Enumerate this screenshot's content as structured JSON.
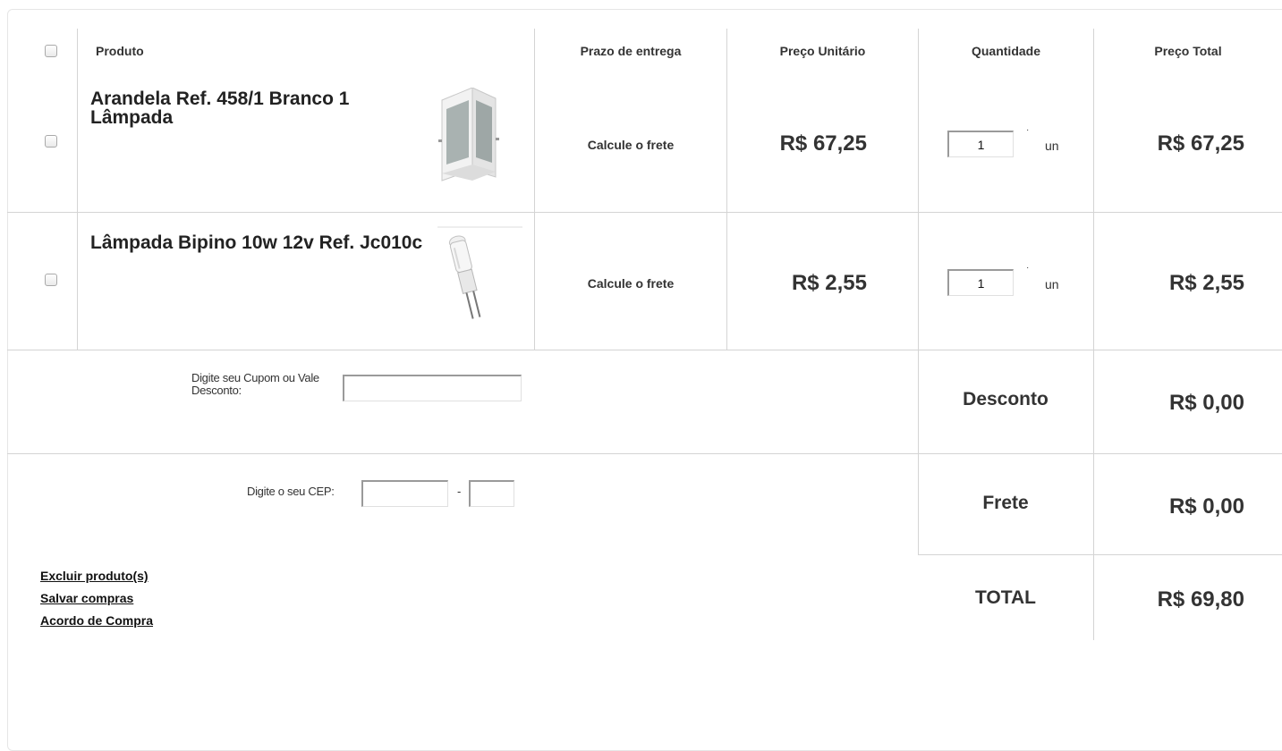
{
  "header": {
    "produto": "Produto",
    "prazo": "Prazo de entrega",
    "preco_unitario": "Preço Unitário",
    "quantidade": "Quantidade",
    "preco_total": "Preço Total"
  },
  "items": [
    {
      "name": "Arandela Ref. 458/1 Branco 1 Lâmpada",
      "image": "wall-sconce-image",
      "shipping": "Calcule o frete",
      "unit_price": "R$ 67,25",
      "quantity": "1",
      "quantity_unit": "un",
      "quantity_mark": "·",
      "total_price": "R$ 67,25"
    },
    {
      "name": "Lâmpada Bipino 10w 12v Ref. Jc010c",
      "image": "bipin-bulb-image",
      "shipping": "Calcule o frete",
      "unit_price": "R$ 2,55",
      "quantity": "1",
      "quantity_unit": "un",
      "quantity_mark": "·",
      "total_price": "R$ 2,55"
    }
  ],
  "coupon": {
    "label": "Digite seu Cupom ou Vale Desconto:",
    "value": ""
  },
  "cep": {
    "label": "Digite o seu CEP:",
    "separator": "-",
    "part1": "",
    "part2": ""
  },
  "summary": {
    "desconto_label": "Desconto",
    "desconto_value": "R$ 0,00",
    "frete_label": "Frete",
    "frete_value": "R$ 0,00",
    "total_label": "TOTAL",
    "total_value": "R$ 69,80"
  },
  "links": {
    "excluir": "Excluir produto(s)",
    "salvar": "Salvar compras",
    "acordo": "Acordo de Compra"
  },
  "colors": {
    "border": "#d4d4d4",
    "text": "#333333"
  }
}
